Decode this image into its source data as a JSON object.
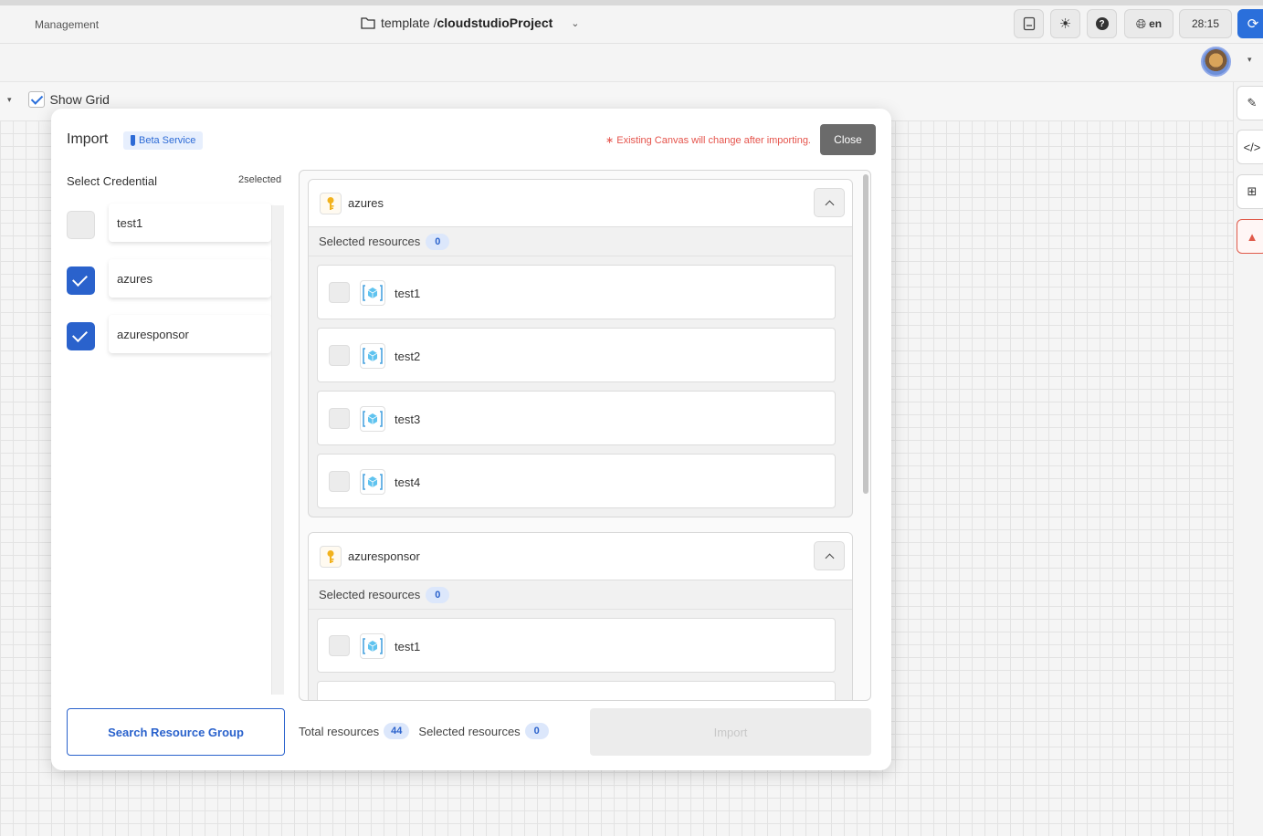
{
  "topbar": {
    "management_label": "Management",
    "project_path": "template / ",
    "project_name": "cloudstudioProject",
    "language": "en",
    "timer": "28:15"
  },
  "toolbar": {
    "show_grid_label": "Show Grid",
    "show_grid_checked": true
  },
  "modal": {
    "title": "Import",
    "beta_label": "Beta Service",
    "warning": "∗ Existing Canvas will change after importing.",
    "close_label": "Close",
    "select_credential_label": "Select Credential",
    "selected_count": "2selected",
    "credentials": [
      {
        "name": "test1",
        "checked": false
      },
      {
        "name": "azures",
        "checked": true
      },
      {
        "name": "azuresponsor",
        "checked": true
      }
    ],
    "groups": [
      {
        "name": "azures",
        "selected_label": "Selected resources",
        "selected_count": "0",
        "resources": [
          "test1",
          "test2",
          "test3",
          "test4"
        ]
      },
      {
        "name": "azuresponsor",
        "selected_label": "Selected resources",
        "selected_count": "0",
        "resources": [
          "test1"
        ]
      }
    ],
    "search_rg_label": "Search Resource Group",
    "total_label": "Total resources",
    "total_count": "44",
    "selected_label": "Selected resources",
    "selected_resources_count": "0",
    "import_label": "Import"
  },
  "colors": {
    "accent": "#2a62cc",
    "warning": "#e5534b",
    "close_button": "#6b6b6b"
  }
}
